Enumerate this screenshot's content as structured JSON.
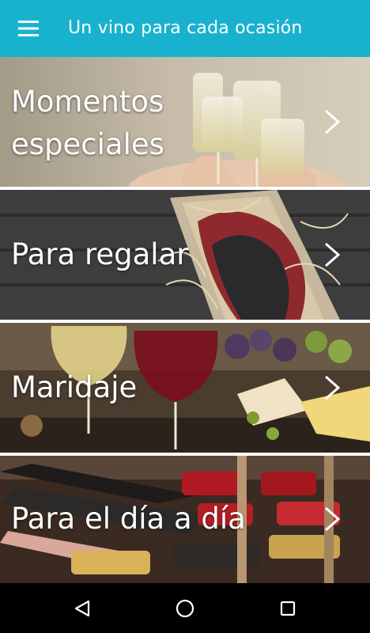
{
  "toolbar": {
    "title": "Un vino para cada ocasión",
    "menu_icon": "hamburger-menu-icon",
    "color": "#18b2cf"
  },
  "cards": [
    {
      "label": "Momentos\nespeciales",
      "icon": "chevron-right-icon"
    },
    {
      "label": "Para regalar",
      "icon": "chevron-right-icon"
    },
    {
      "label": "Maridaje",
      "icon": "chevron-right-icon"
    },
    {
      "label": "Para el día a día",
      "icon": "chevron-right-icon"
    }
  ],
  "navbar": {
    "back_icon": "back-triangle-icon",
    "home_icon": "home-circle-icon",
    "recents_icon": "recents-square-icon"
  }
}
